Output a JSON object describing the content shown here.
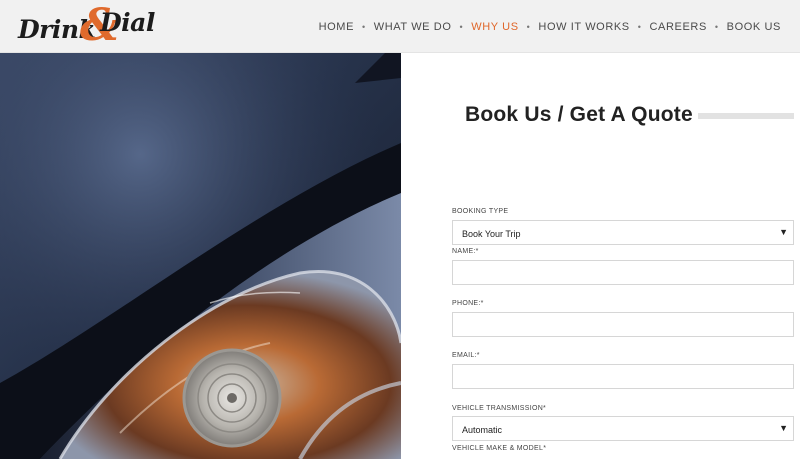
{
  "brand": {
    "logo_word1": "Drink",
    "logo_amp": "&",
    "logo_word2": "Dial",
    "logo_color": "#e06a2c"
  },
  "nav": {
    "items": [
      {
        "label": "HOME"
      },
      {
        "label": "WHAT WE DO"
      },
      {
        "label": "WHY US",
        "active": true
      },
      {
        "label": "HOW IT WORKS"
      },
      {
        "label": "CAREERS"
      },
      {
        "label": "BOOK US"
      }
    ],
    "separator": "•",
    "active_color": "#e0672a"
  },
  "form": {
    "title": "Book Us / Get A Quote",
    "booking_type": {
      "label": "BOOKING TYPE",
      "value": "Book Your Trip"
    },
    "name": {
      "label": "NAME:*",
      "value": ""
    },
    "phone": {
      "label": "PHONE:*",
      "value": ""
    },
    "email": {
      "label": "EMAIL:*",
      "value": ""
    },
    "transmission": {
      "label": "VEHICLE TRANSMISSION*",
      "value": "Automatic"
    },
    "make_model": {
      "label": "VEHICLE MAKE & MODEL*"
    },
    "select_arrow": "▼"
  }
}
